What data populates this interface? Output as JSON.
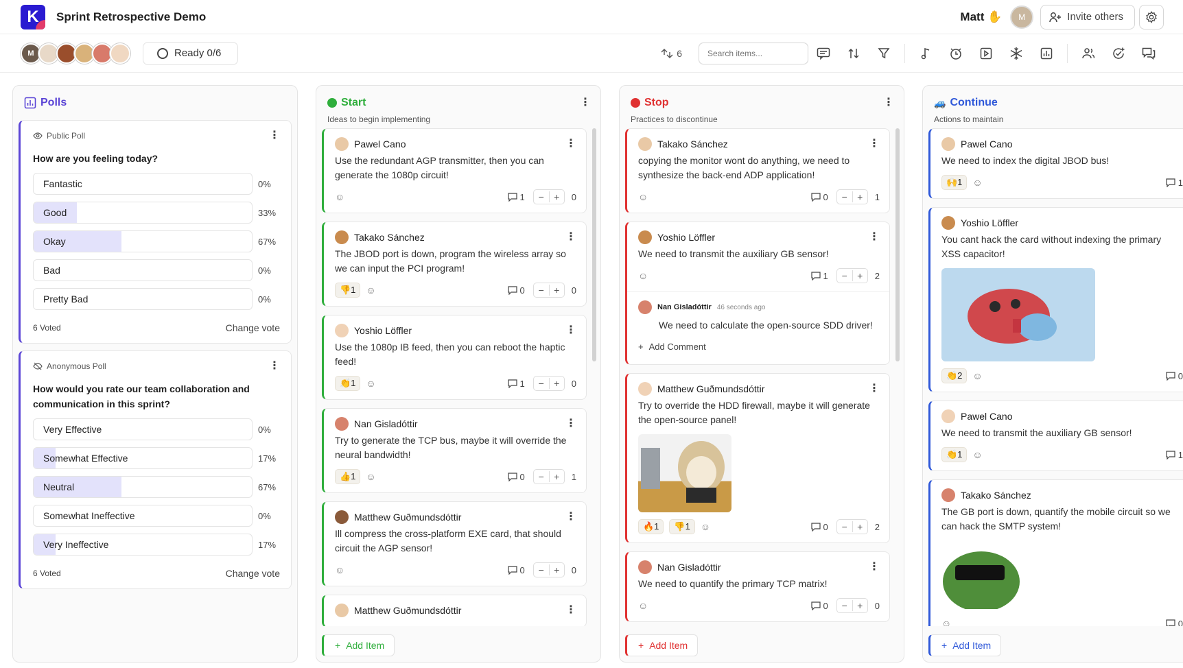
{
  "app": {
    "title": "Sprint Retrospective Demo",
    "logo_letter": "K",
    "user": "Matt",
    "invite_label": "Invite others"
  },
  "toolbar": {
    "ready_label": "Ready 0/6",
    "votes_count": "6",
    "search_placeholder": "Search items..."
  },
  "colors": {
    "accent": "#5b45d6",
    "start": "#2fae3c",
    "stop": "#e03131",
    "continue": "#2f58d9"
  },
  "polls": {
    "title": "Polls",
    "items": [
      {
        "type": "Public Poll",
        "question": "How are you feeling today?",
        "options": [
          {
            "label": "Fantastic",
            "pct": "0%",
            "value": 0
          },
          {
            "label": "Good",
            "pct": "33%",
            "value": 33
          },
          {
            "label": "Okay",
            "pct": "67%",
            "value": 67
          },
          {
            "label": "Bad",
            "pct": "0%",
            "value": 0
          },
          {
            "label": "Pretty Bad",
            "pct": "0%",
            "value": 0
          }
        ],
        "voted": "6 Voted",
        "change": "Change vote"
      },
      {
        "type": "Anonymous Poll",
        "question": "How would you rate our team collaboration and communication in this sprint?",
        "options": [
          {
            "label": "Very Effective",
            "pct": "0%",
            "value": 0
          },
          {
            "label": "Somewhat Effective",
            "pct": "17%",
            "value": 17
          },
          {
            "label": "Neutral",
            "pct": "67%",
            "value": 67
          },
          {
            "label": "Somewhat Ineffective",
            "pct": "0%",
            "value": 0
          },
          {
            "label": "Very Ineffective",
            "pct": "17%",
            "value": 17
          }
        ],
        "voted": "6 Voted",
        "change": "Change vote"
      }
    ]
  },
  "columns": [
    {
      "key": "start",
      "title": "Start",
      "subtitle": "Ideas to begin implementing",
      "add": "Add Item",
      "cards": [
        {
          "author": "Pawel Cano",
          "text": "Use the redundant AGP transmitter, then you can generate the 1080p circuit!",
          "react": "",
          "comments": "1",
          "votes": "0"
        },
        {
          "author": "Takako Sánchez",
          "text": "The JBOD port is down, program the wireless array so we can input the PCI program!",
          "react": "👎1",
          "comments": "0",
          "votes": "0"
        },
        {
          "author": "Yoshio Löffler",
          "text": "Use the 1080p IB feed, then you can reboot the haptic feed!",
          "react": "👏1",
          "comments": "1",
          "votes": "0"
        },
        {
          "author": "Nan Gisladóttir",
          "text": "Try to generate the TCP bus, maybe it will override the neural bandwidth!",
          "react": "👍1",
          "comments": "0",
          "votes": "1"
        },
        {
          "author": "Matthew Guðmundsdóttir",
          "text": "Ill compress the cross-platform EXE card, that should circuit the AGP sensor!",
          "react": "",
          "comments": "0",
          "votes": "0"
        },
        {
          "author": "Matthew Guðmundsdóttir",
          "text": "",
          "react": "",
          "comments": "0",
          "votes": "0"
        }
      ]
    },
    {
      "key": "stop",
      "title": "Stop",
      "subtitle": "Practices to discontinue",
      "add": "Add Item",
      "cards": [
        {
          "author": "Takako Sánchez",
          "text": "copying the monitor wont do anything, we need to synthesize the back-end ADP application!",
          "react": "",
          "comments": "0",
          "votes": "1"
        },
        {
          "author": "Yoshio Löffler",
          "text": "We need to transmit the auxiliary GB sensor!",
          "react": "",
          "comments": "1",
          "votes": "2",
          "comment": {
            "author": "Nan Gisladóttir",
            "time": "46 seconds ago",
            "text": "We need to calculate the open-source SDD driver!"
          },
          "add_comment": "Add Comment"
        },
        {
          "author": "Matthew Guðmundsdóttir",
          "text": "Try to override the HDD firewall, maybe it will generate the open-source panel!",
          "react": "🔥1",
          "react2": "👎1",
          "comments": "0",
          "votes": "2"
        },
        {
          "author": "Nan Gisladóttir",
          "text": "We need to quantify the primary TCP matrix!",
          "react": "",
          "comments": "0",
          "votes": "0"
        }
      ]
    },
    {
      "key": "continue",
      "title": "Continue",
      "subtitle": "Actions to maintain",
      "add": "Add Item",
      "cards": [
        {
          "author": "Pawel Cano",
          "text": "We need to index the digital JBOD bus!",
          "react": "🙌1",
          "comments": "1",
          "votes": ""
        },
        {
          "author": "Yoshio Löffler",
          "text": "You cant hack the card without indexing the primary XSS capacitor!",
          "react": "👏2",
          "comments": "0",
          "votes": ""
        },
        {
          "author": "Pawel Cano",
          "text": "We need to transmit the auxiliary GB sensor!",
          "react": "👏1",
          "comments": "1",
          "votes": ""
        },
        {
          "author": "Takako Sánchez",
          "text": "The GB port is down, quantify the mobile circuit so we can hack the SMTP system!",
          "react": "",
          "comments": "0",
          "votes": ""
        }
      ]
    }
  ]
}
